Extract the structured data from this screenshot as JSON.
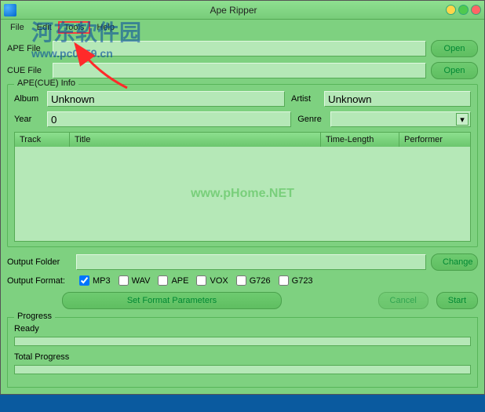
{
  "window": {
    "title": "Ape Ripper"
  },
  "menu": {
    "file": "File",
    "edit": "Edit",
    "tools": "Tools",
    "help": "Help"
  },
  "labels": {
    "ape_file": "APE File",
    "cue_file": "CUE File",
    "open": "Open",
    "change": "Change",
    "info_legend": "APE(CUE) Info",
    "album": "Album",
    "artist": "Artist",
    "year": "Year",
    "genre": "Genre",
    "output_folder": "Output Folder",
    "output_format": "Output Format:",
    "set_params": "Set Format Parameters",
    "cancel": "Cancel",
    "start": "Start",
    "progress": "Progress",
    "ready": "Ready",
    "total_progress": "Total Progress"
  },
  "info": {
    "album": "Unknown",
    "artist": "Unknown",
    "year": "0",
    "genre": ""
  },
  "table": {
    "headers": [
      "Track",
      "Title",
      "Time-Length",
      "Performer"
    ]
  },
  "formats": [
    {
      "label": "MP3",
      "checked": true
    },
    {
      "label": "WAV",
      "checked": false
    },
    {
      "label": "APE",
      "checked": false
    },
    {
      "label": "VOX",
      "checked": false
    },
    {
      "label": "G726",
      "checked": false
    },
    {
      "label": "G723",
      "checked": false
    }
  ],
  "watermarks": {
    "center": "www.pHome.NET",
    "top_main": "河东软件园",
    "top_sub": "www.pc0359.cn"
  }
}
